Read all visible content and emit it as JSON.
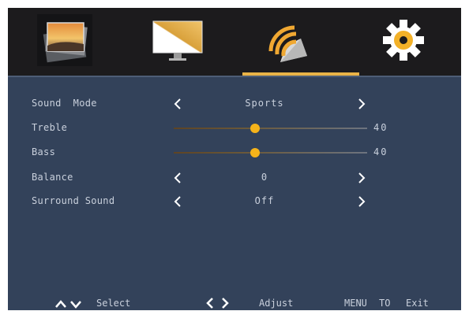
{
  "tabs": [
    {
      "icon": "picture-icon",
      "active": false
    },
    {
      "icon": "display-icon",
      "active": false
    },
    {
      "icon": "sound-icon",
      "active": true
    },
    {
      "icon": "settings-gear-icon",
      "active": false
    }
  ],
  "colors": {
    "accent": "#e9b347",
    "panel_bg": "#33425a",
    "tabbar_bg": "#1c1b1d",
    "slider_knob": "#f5b31a",
    "text": "#c9d0dc"
  },
  "menu": {
    "sound_mode": {
      "label": "Sound  Mode",
      "value": "Sports"
    },
    "treble": {
      "label": "Treble",
      "value": "40",
      "level": 0.42
    },
    "bass": {
      "label": "Bass",
      "value": "40",
      "level": 0.42
    },
    "balance": {
      "label": "Balance",
      "value": "0"
    },
    "surround": {
      "label": "Surround Sound",
      "value": "Off"
    }
  },
  "footer": {
    "select_label": "Select",
    "adjust_label": "Adjust",
    "menu_label": "MENU",
    "to_label": "TO",
    "exit_label": "Exit"
  }
}
